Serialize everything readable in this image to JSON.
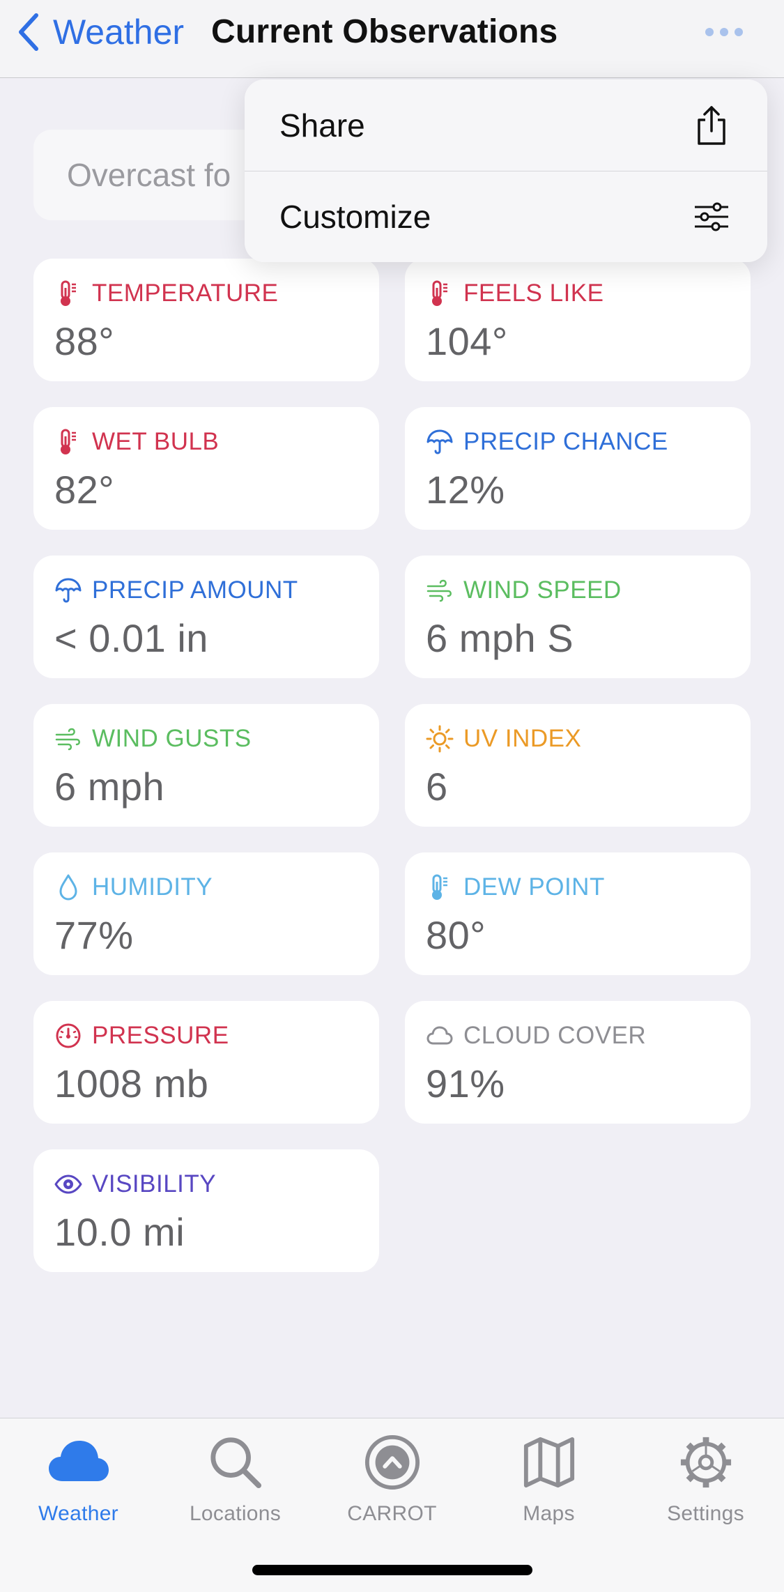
{
  "header": {
    "back_label": "Weather",
    "title": "Current Observations"
  },
  "summary": {
    "text": "Overcast fo"
  },
  "menu": {
    "items": [
      {
        "label": "Share",
        "icon": "share-icon"
      },
      {
        "label": "Customize",
        "icon": "sliders-icon"
      }
    ]
  },
  "cards": [
    {
      "label": "TEMPERATURE",
      "value": "88°",
      "icon": "thermometer-icon",
      "color": "#d1334f"
    },
    {
      "label": "FEELS LIKE",
      "value": "104°",
      "icon": "thermometer-icon",
      "color": "#d1334f"
    },
    {
      "label": "WET BULB",
      "value": "82°",
      "icon": "thermometer-icon",
      "color": "#d1334f"
    },
    {
      "label": "PRECIP CHANCE",
      "value": "12%",
      "icon": "umbrella-icon",
      "color": "#2f6fd8"
    },
    {
      "label": "PRECIP AMOUNT",
      "value": "< 0.01 in",
      "icon": "umbrella-icon",
      "color": "#2f6fd8"
    },
    {
      "label": "WIND SPEED",
      "value": "6 mph S",
      "icon": "wind-icon",
      "color": "#5bbd60"
    },
    {
      "label": "WIND GUSTS",
      "value": "6 mph",
      "icon": "wind-icon",
      "color": "#5bbd60"
    },
    {
      "label": "UV INDEX",
      "value": "6",
      "icon": "sun-icon",
      "color": "#eb9a26"
    },
    {
      "label": "HUMIDITY",
      "value": "77%",
      "icon": "drop-icon",
      "color": "#5db3e6"
    },
    {
      "label": "DEW POINT",
      "value": "80°",
      "icon": "thermometer-icon",
      "color": "#5db3e6"
    },
    {
      "label": "PRESSURE",
      "value": "1008 mb",
      "icon": "gauge-icon",
      "color": "#d1334f"
    },
    {
      "label": "CLOUD COVER",
      "value": "91%",
      "icon": "cloud-icon",
      "color": "#8e8e93"
    },
    {
      "label": "VISIBILITY",
      "value": "10.0 mi",
      "icon": "eye-icon",
      "color": "#5847c2"
    }
  ],
  "tabs": [
    {
      "label": "Weather",
      "icon": "cloud-icon",
      "active": true
    },
    {
      "label": "Locations",
      "icon": "search-icon",
      "active": false
    },
    {
      "label": "CARROT",
      "icon": "carrot-logo-icon",
      "active": false
    },
    {
      "label": "Maps",
      "icon": "map-icon",
      "active": false
    },
    {
      "label": "Settings",
      "icon": "gear-icon",
      "active": false
    }
  ],
  "colors": {
    "accent": "#2f7bea",
    "background": "#f0eff5",
    "tab_inactive": "#8e8e93"
  }
}
